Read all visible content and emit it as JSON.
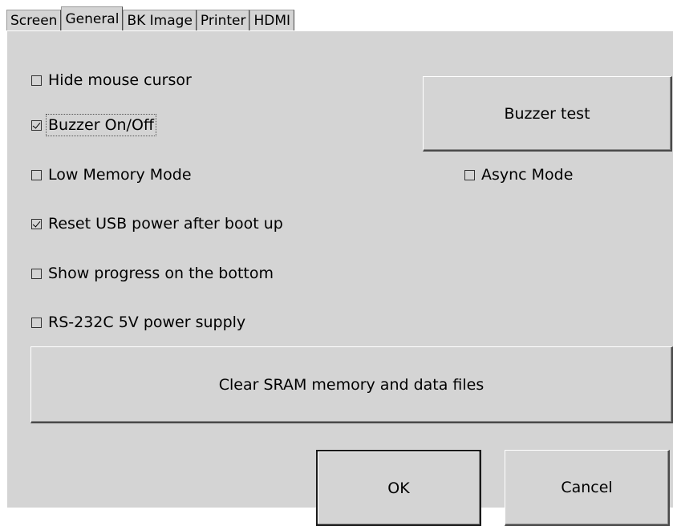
{
  "tabs": [
    {
      "label": "Screen"
    },
    {
      "label": "General"
    },
    {
      "label": "BK Image"
    },
    {
      "label": "Printer"
    },
    {
      "label": "HDMI"
    }
  ],
  "active_tab": "General",
  "options": {
    "hide_mouse_cursor": {
      "label": "Hide mouse cursor",
      "checked": false
    },
    "buzzer": {
      "label": "Buzzer On/Off",
      "checked": true
    },
    "low_memory": {
      "label": "Low Memory Mode",
      "checked": false
    },
    "async_mode": {
      "label": "Async Mode",
      "checked": false
    },
    "reset_usb": {
      "label": "Reset USB power after boot up",
      "checked": true
    },
    "show_progress": {
      "label": "Show progress on the bottom",
      "checked": false
    },
    "rs232": {
      "label": "RS-232C 5V power supply",
      "checked": false
    }
  },
  "buttons": {
    "buzzer_test": "Buzzer test",
    "clear_sram": "Clear SRAM memory and data files",
    "ok": "OK",
    "cancel": "Cancel"
  },
  "colors": {
    "panel_bg": "#d4d4d4",
    "text": "#000000"
  }
}
